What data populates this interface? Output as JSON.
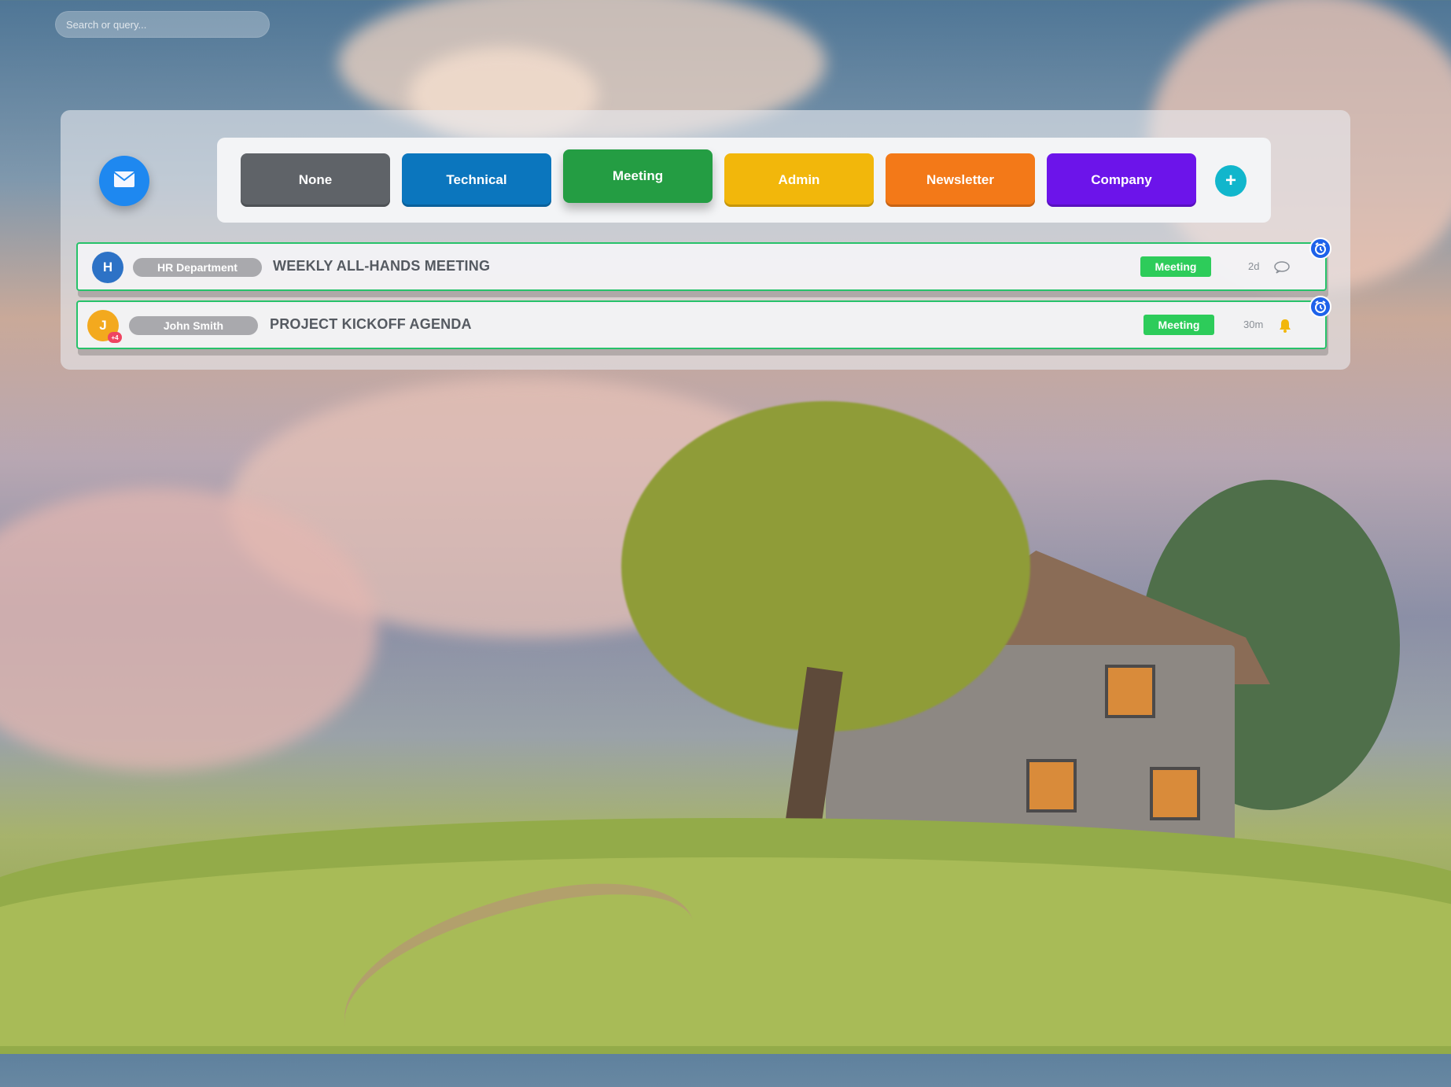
{
  "search": {
    "placeholder": "Search or query..."
  },
  "toolbar": {
    "tags": [
      {
        "label": "None",
        "color": "#5f6368"
      },
      {
        "label": "Technical",
        "color": "#0b76be"
      },
      {
        "label": "Meeting",
        "color": "#249d43"
      },
      {
        "label": "Admin",
        "color": "#f2b70b"
      },
      {
        "label": "Newsletter",
        "color": "#f37918"
      },
      {
        "label": "Company",
        "color": "#6c14ea"
      }
    ],
    "active_tag": "Meeting",
    "add_label": "+"
  },
  "emails": [
    {
      "avatar_initial": "H",
      "avatar_color": "#2d72c6",
      "sender": "HR Department",
      "subject": "WEEKLY ALL-HANDS MEETING",
      "category": "Meeting",
      "time": "2d",
      "status_icon": "comment-icon"
    },
    {
      "avatar_initial": "J",
      "avatar_color": "#f3a91e",
      "avatar_badge": "+4",
      "sender": "John Smith",
      "subject": "PROJECT KICKOFF AGENDA",
      "category": "Meeting",
      "time": "30m",
      "status_icon": "bell-icon"
    }
  ],
  "icons": {
    "compose": "mail-icon",
    "reminder": "alarm-clock-icon"
  }
}
